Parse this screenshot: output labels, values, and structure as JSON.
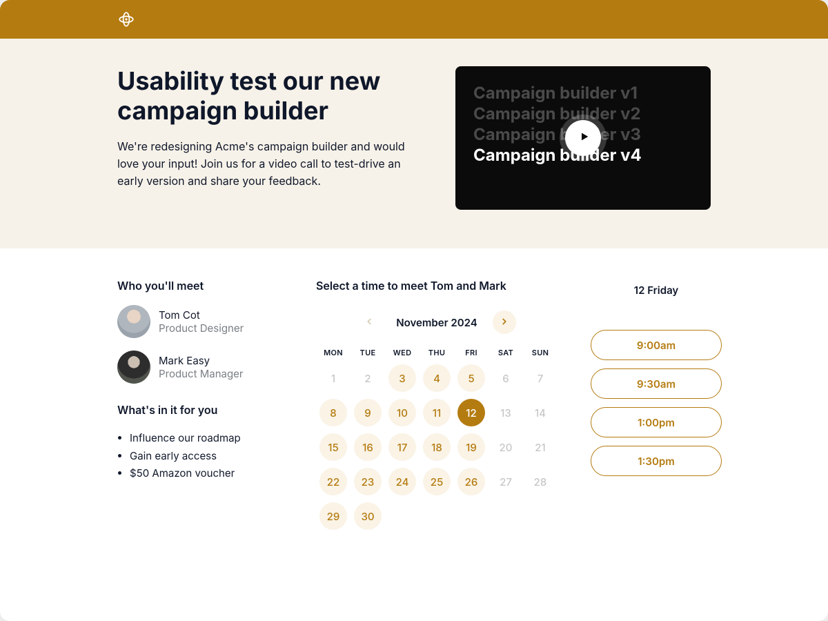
{
  "hero": {
    "title": "Usability test our new campaign builder",
    "body": "We're redesigning Acme's campaign builder and would love your input! Join us for a video call to test-drive an early version and share your feedback."
  },
  "video": {
    "lines": [
      "Campaign builder v1",
      "Campaign builder v2",
      "Campaign builder v3",
      "Campaign builder v4"
    ]
  },
  "who": {
    "heading": "Who you'll meet",
    "people": [
      {
        "name": "Tom Cot",
        "role": "Product Designer"
      },
      {
        "name": "Mark Easy",
        "role": "Product Manager"
      }
    ]
  },
  "benefits": {
    "heading": "What's in it for you",
    "items": [
      "Influence our roadmap",
      "Gain early access",
      "$50 Amazon voucher"
    ]
  },
  "schedule": {
    "heading": "Select a time to meet Tom and Mark",
    "month": "November 2024",
    "dow": [
      "MON",
      "TUE",
      "WED",
      "THU",
      "FRI",
      "SAT",
      "SUN"
    ],
    "days": [
      {
        "n": "1",
        "s": "unavail"
      },
      {
        "n": "2",
        "s": "unavail"
      },
      {
        "n": "3",
        "s": "avail"
      },
      {
        "n": "4",
        "s": "avail"
      },
      {
        "n": "5",
        "s": "avail"
      },
      {
        "n": "6",
        "s": "unavail"
      },
      {
        "n": "7",
        "s": "unavail"
      },
      {
        "n": "8",
        "s": "avail"
      },
      {
        "n": "9",
        "s": "avail"
      },
      {
        "n": "10",
        "s": "avail"
      },
      {
        "n": "11",
        "s": "avail"
      },
      {
        "n": "12",
        "s": "sel"
      },
      {
        "n": "13",
        "s": "unavail"
      },
      {
        "n": "14",
        "s": "unavail"
      },
      {
        "n": "15",
        "s": "avail"
      },
      {
        "n": "16",
        "s": "avail"
      },
      {
        "n": "17",
        "s": "avail"
      },
      {
        "n": "18",
        "s": "avail"
      },
      {
        "n": "19",
        "s": "avail"
      },
      {
        "n": "20",
        "s": "unavail"
      },
      {
        "n": "21",
        "s": "unavail"
      },
      {
        "n": "22",
        "s": "avail"
      },
      {
        "n": "23",
        "s": "avail"
      },
      {
        "n": "24",
        "s": "avail"
      },
      {
        "n": "25",
        "s": "avail"
      },
      {
        "n": "26",
        "s": "avail"
      },
      {
        "n": "27",
        "s": "unavail"
      },
      {
        "n": "28",
        "s": "unavail"
      },
      {
        "n": "29",
        "s": "avail"
      },
      {
        "n": "30",
        "s": "avail"
      }
    ],
    "selected_label": "12 Friday",
    "slots": [
      "9:00am",
      "9:30am",
      "1:00pm",
      "1:30pm"
    ]
  }
}
